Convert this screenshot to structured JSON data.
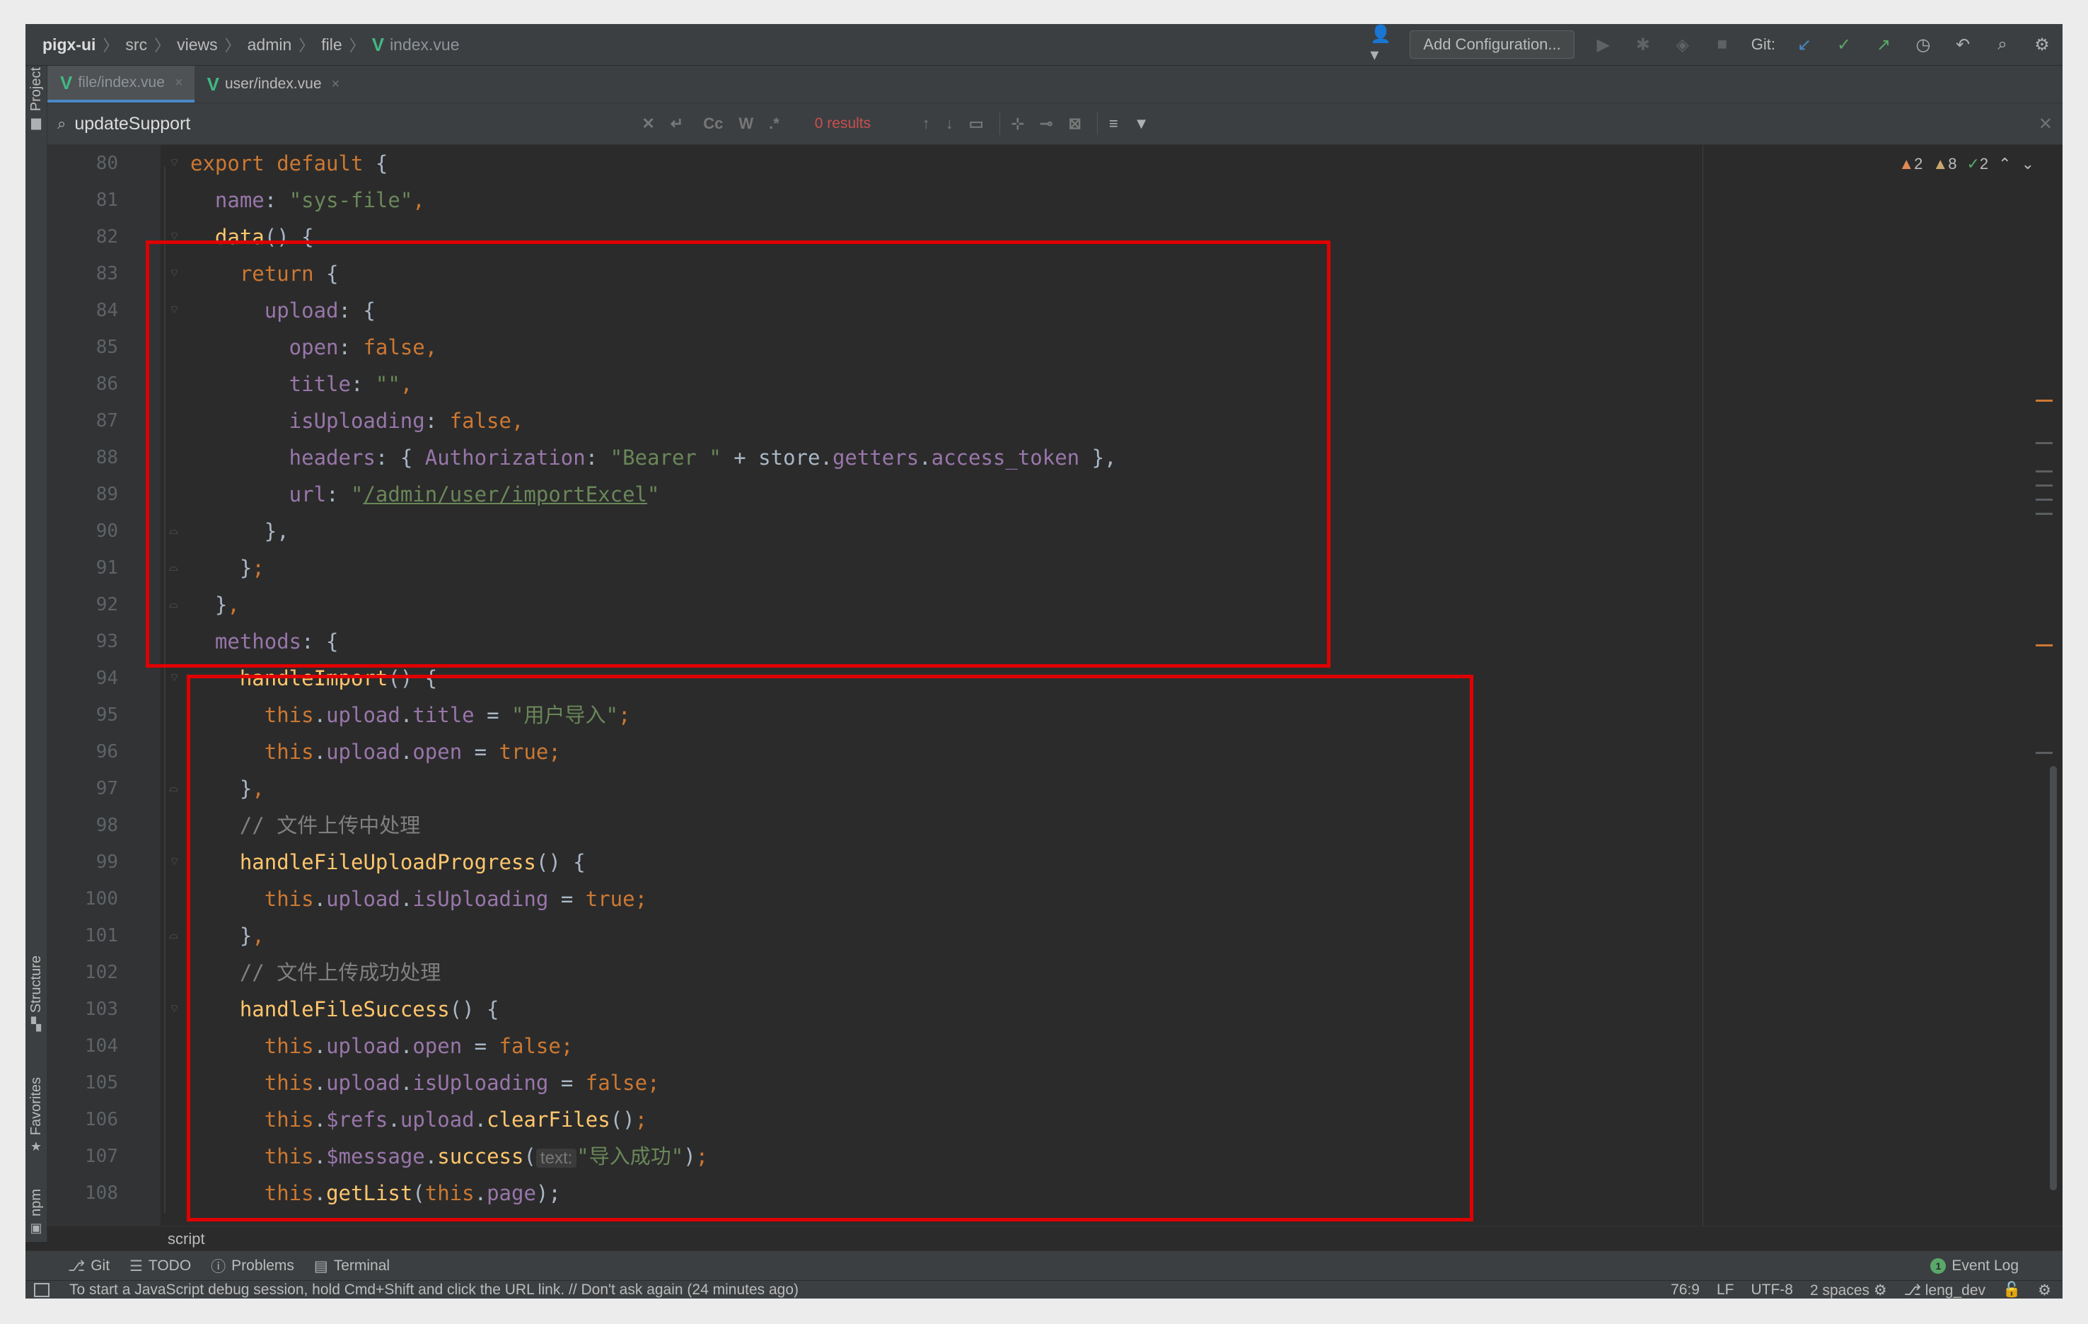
{
  "navbar": {
    "breadcrumbs": [
      "pigx-ui",
      "src",
      "views",
      "admin",
      "file"
    ],
    "file": "index.vue",
    "add_configuration": "Add Configuration...",
    "git_label": "Git:"
  },
  "tabs": [
    {
      "label": "file/index.vue",
      "active": true
    },
    {
      "label": "user/index.vue",
      "active": false
    }
  ],
  "search": {
    "query": "updateSupport",
    "case_btn": "Cc",
    "word_btn": "W",
    "regex_btn": ".*",
    "results": "0 results"
  },
  "inspections": {
    "warnings": "2",
    "weak_warnings": "8",
    "typos": "2"
  },
  "line_numbers": [
    "80",
    "81",
    "82",
    "83",
    "84",
    "85",
    "86",
    "87",
    "88",
    "89",
    "90",
    "91",
    "92",
    "93",
    "94",
    "95",
    "96",
    "97",
    "98",
    "99",
    "100",
    "101",
    "102",
    "103",
    "104",
    "105",
    "106",
    "107",
    "108"
  ],
  "code": {
    "l80a": "export default",
    "l80b": " {",
    "l81a": "  name",
    "l81b": ": ",
    "l81c": "\"sys-file\"",
    "l81d": ",",
    "l82a": "  ",
    "l82b": "data",
    "l82c": "() {",
    "l83a": "    ",
    "l83b": "return",
    "l83c": " {",
    "l84a": "      upload",
    "l84b": ": {",
    "l85a": "        open",
    "l85b": ": ",
    "l85c": "false,",
    "l86a": "        title",
    "l86b": ": ",
    "l86c": "\"\"",
    "l86d": ",",
    "l87a": "        isUploading",
    "l87b": ": ",
    "l87c": "false,",
    "l88a": "        headers",
    "l88b": ": { ",
    "l88c": "Authorization",
    "l88d": ": ",
    "l88e": "\"Bearer \"",
    "l88f": " + store.",
    "l88g": "getters",
    "l88h": ".",
    "l88i": "access_token",
    "l88j": " },",
    "l89a": "        url",
    "l89b": ": ",
    "l89c": "\"",
    "l89d": "/admin/user/importExcel",
    "l89e": "\"",
    "l90a": "      },",
    "l91a": "    }",
    "l91b": ";",
    "l92a": "  }",
    "l92b": ",",
    "l93a": "  methods",
    "l93b": ": {",
    "l94a": "    ",
    "l94b": "handleImport",
    "l94c": "() {",
    "l95a": "      ",
    "l95b": "this",
    "l95c": ".",
    "l95d": "upload",
    "l95e": ".",
    "l95f": "title",
    "l95g": " = ",
    "l95h": "\"用户导入\"",
    "l95i": ";",
    "l96a": "      ",
    "l96b": "this",
    "l96c": ".",
    "l96d": "upload",
    "l96e": ".",
    "l96f": "open",
    "l96g": " = ",
    "l96h": "true;",
    "l97a": "    }",
    "l97b": ",",
    "l98a": "    // 文件上传中处理",
    "l99a": "    ",
    "l99b": "handleFileUploadProgress",
    "l99c": "() {",
    "l100a": "      ",
    "l100b": "this",
    "l100c": ".",
    "l100d": "upload",
    "l100e": ".",
    "l100f": "isUploading",
    "l100g": " = ",
    "l100h": "true;",
    "l101a": "    }",
    "l101b": ",",
    "l102a": "    // 文件上传成功处理",
    "l103a": "    ",
    "l103b": "handleFileSuccess",
    "l103c": "() {",
    "l104a": "      ",
    "l104b": "this",
    "l104c": ".",
    "l104d": "upload",
    "l104e": ".",
    "l104f": "open",
    "l104g": " = ",
    "l104h": "false;",
    "l105a": "      ",
    "l105b": "this",
    "l105c": ".",
    "l105d": "upload",
    "l105e": ".",
    "l105f": "isUploading",
    "l105g": " = ",
    "l105h": "false;",
    "l106a": "      ",
    "l106b": "this",
    "l106c": ".",
    "l106d": "$refs",
    "l106e": ".",
    "l106f": "upload",
    "l106g": ".",
    "l106h": "clearFiles",
    "l106i": "()",
    "l106j": ";",
    "l107a": "      ",
    "l107b": "this",
    "l107c": ".",
    "l107d": "$message",
    "l107e": ".",
    "l107f": "success",
    "l107g": "(",
    "l107hint": "text:",
    "l107h": "\"导入成功\"",
    "l107i": ")",
    "l107j": ";",
    "l108a": "      ",
    "l108b": "this",
    "l108c": ".",
    "l108d": "getList",
    "l108e": "(",
    "l108f": "this",
    "l108g": ".",
    "l108h": "page",
    "l108i": ");"
  },
  "editor_crumb": "script",
  "left_tabs": {
    "project": "Project",
    "structure": "Structure",
    "favorites": "Favorites",
    "npm": "npm"
  },
  "tool_windows": {
    "git": "Git",
    "todo": "TODO",
    "problems": "Problems",
    "terminal": "Terminal",
    "event_log": "Event Log",
    "event_count": "1"
  },
  "status": {
    "message": "To start a JavaScript debug session, hold Cmd+Shift and click the URL link. // Don't ask again (24 minutes ago)",
    "position": "76:9",
    "line_sep": "LF",
    "encoding": "UTF-8",
    "indent": "2 spaces",
    "branch": "leng_dev"
  }
}
